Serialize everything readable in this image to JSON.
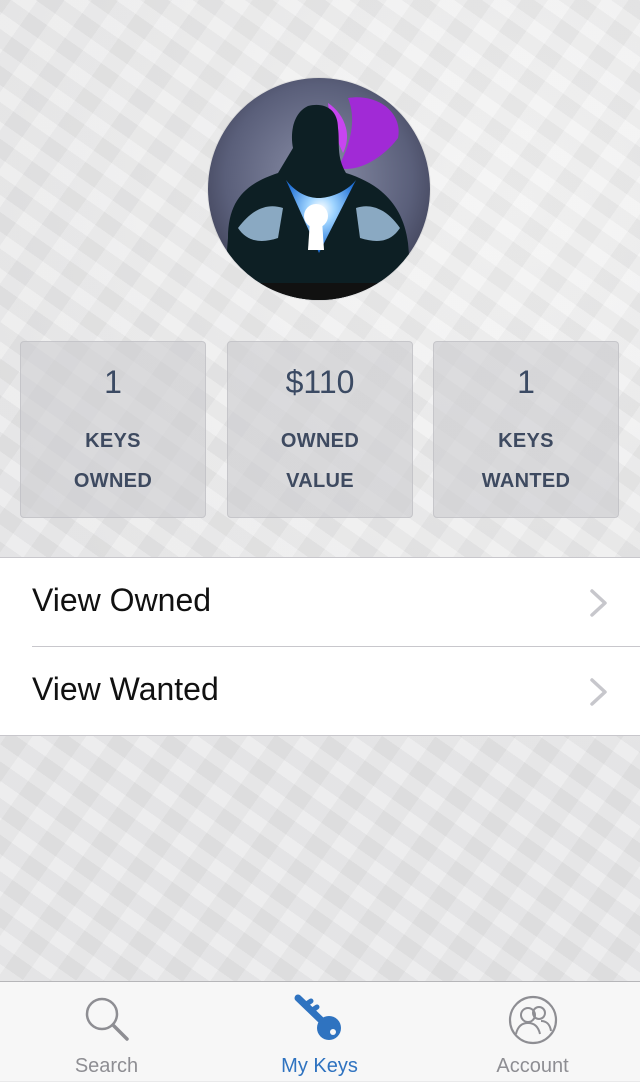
{
  "stats": [
    {
      "value": "1",
      "line1": "KEYS",
      "line2": "OWNED"
    },
    {
      "value": "$110",
      "line1": "OWNED",
      "line2": "VALUE"
    },
    {
      "value": "1",
      "line1": "KEYS",
      "line2": "WANTED"
    }
  ],
  "menu": {
    "view_owned": "View Owned",
    "view_wanted": "View Wanted"
  },
  "tabbar": {
    "search": "Search",
    "my_keys": "My Keys",
    "account": "Account",
    "active_tab": "My Keys"
  },
  "icons": {
    "avatar": "hero-keyhole-avatar",
    "row_chevron": "chevron-right-icon",
    "search": "search-icon",
    "my_keys": "key-icon",
    "account": "account-icon"
  },
  "colors": {
    "accent": "#2f73c0",
    "tab_inactive": "#8e8e93",
    "stat_text": "#3e4a60"
  }
}
